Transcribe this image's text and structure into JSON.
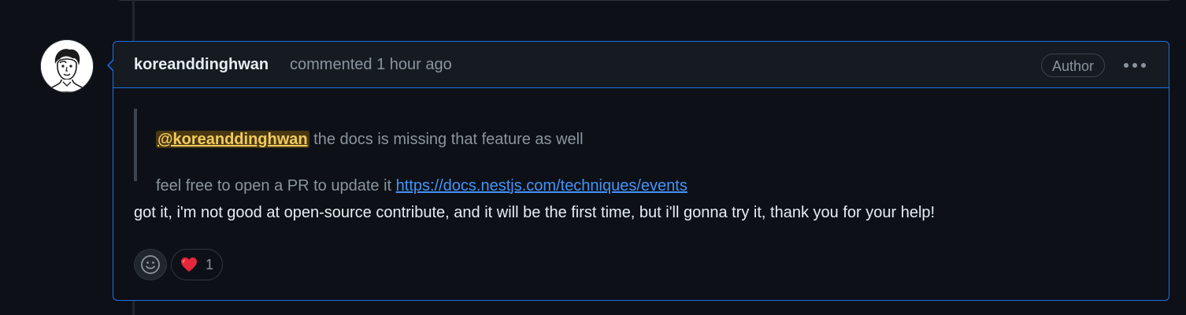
{
  "comment": {
    "author": "koreanddinghwan",
    "action": "commented",
    "time": "1 hour ago",
    "badge": "Author",
    "quote": {
      "mention": "@koreanddinghwan",
      "line1_rest": " the docs is missing that feature as well",
      "line2_text": "feel free to open a PR to update it ",
      "line2_link": "https://docs.nestjs.com/techniques/events"
    },
    "body": "got it, i'm not good at open-source contribute, and it will be the first time, but i'll gonna try it, thank you for your help!",
    "reactions": [
      {
        "emoji": "❤️",
        "count": "1"
      }
    ]
  },
  "icons": {
    "avatar": "user-avatar-icon",
    "more": "kebab-horizontal-icon",
    "emoji_picker": "smiley-icon",
    "reaction": "heart-icon"
  },
  "colors": {
    "background": "#0d1117",
    "header": "#161b22",
    "border_highlight": "#1f6feb",
    "text": "#e6edf3",
    "muted": "#8b949e",
    "link": "#4493f8",
    "mention": "#f2cc60"
  }
}
